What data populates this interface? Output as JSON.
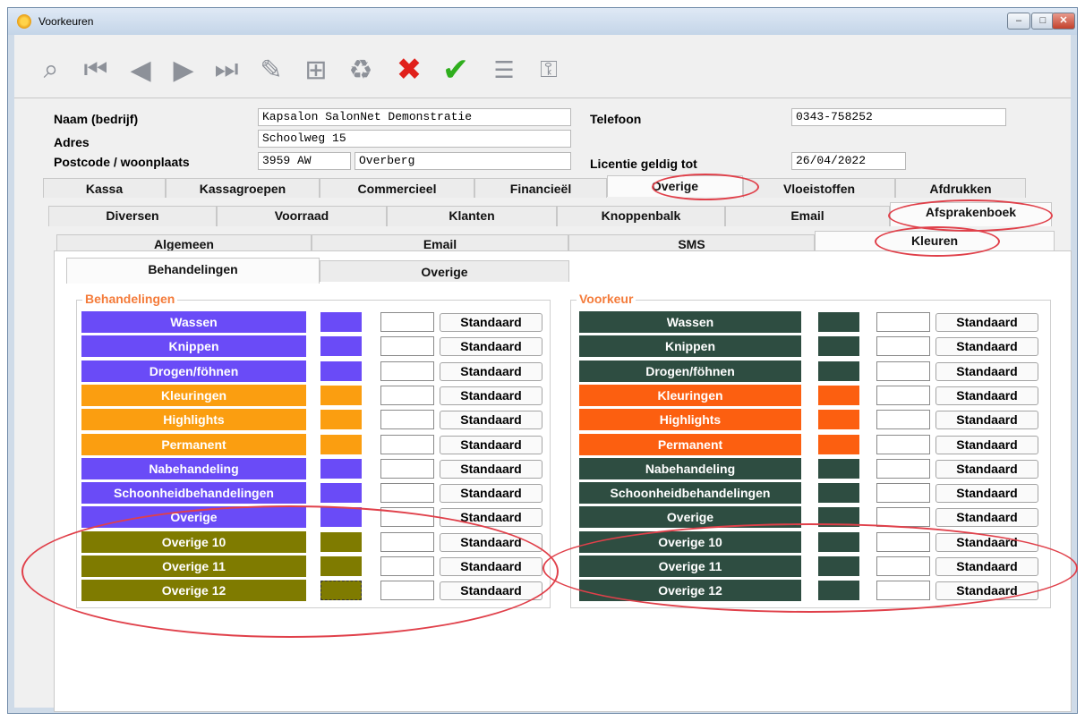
{
  "window": {
    "title": "Voorkeuren"
  },
  "toolbar": {
    "icons": [
      "search-icon",
      "first-record-icon",
      "previous-record-icon",
      "next-record-icon",
      "last-record-icon",
      "edit-icon",
      "add-icon",
      "trash-icon",
      "cancel-icon",
      "confirm-icon",
      "list-icon",
      "keys-icon"
    ]
  },
  "form": {
    "naam_label": "Naam (bedrijf)",
    "naam_value": "Kapsalon SalonNet Demonstratie",
    "adres_label": "Adres",
    "adres_value": "Schoolweg 15",
    "postcode_label": "Postcode / woonplaats",
    "postcode_value": "3959 AW",
    "woonplaats_value": "Overberg",
    "telefoon_label": "Telefoon",
    "telefoon_value": "0343-758252",
    "licentie_label": "Licentie geldig tot",
    "licentie_value": "26/04/2022"
  },
  "tabs_main": [
    "Kassa",
    "Kassagroepen",
    "Commercieel",
    "Financieël",
    "Overige",
    "Vloeistoffen",
    "Afdrukken"
  ],
  "tabs_sub": [
    "Diversen",
    "Voorraad",
    "Klanten",
    "Knoppenbalk",
    "Email",
    "Afsprakenboek"
  ],
  "tabs_sub2": [
    "Algemeen",
    "Email",
    "SMS",
    "Kleuren"
  ],
  "tabs_sub3": [
    "Behandelingen",
    "Overige"
  ],
  "groups": {
    "left_title": "Behandelingen",
    "right_title": "Voorkeur",
    "button_label": "Standaard"
  },
  "rows_left": [
    {
      "label": "Wassen",
      "color": "#6a4bf7"
    },
    {
      "label": "Knippen",
      "color": "#6a4bf7"
    },
    {
      "label": "Drogen/föhnen",
      "color": "#6a4bf7"
    },
    {
      "label": "Kleuringen",
      "color": "#fb9e10"
    },
    {
      "label": "Highlights",
      "color": "#fb9e10"
    },
    {
      "label": "Permanent",
      "color": "#fb9e10"
    },
    {
      "label": "Nabehandeling",
      "color": "#6a4bf7"
    },
    {
      "label": "Schoonheidbehandelingen",
      "color": "#6a4bf7"
    },
    {
      "label": "Overige",
      "color": "#6a4bf7"
    },
    {
      "label": "Overige 10",
      "color": "#7f7b00"
    },
    {
      "label": "Overige 11",
      "color": "#7f7b00"
    },
    {
      "label": "Overige 12",
      "color": "#7f7b00"
    }
  ],
  "rows_right": [
    {
      "label": "Wassen",
      "color": "#2e4d41"
    },
    {
      "label": "Knippen",
      "color": "#2e4d41"
    },
    {
      "label": "Drogen/föhnen",
      "color": "#2e4d41"
    },
    {
      "label": "Kleuringen",
      "color": "#fc5f10"
    },
    {
      "label": "Highlights",
      "color": "#fc5f10"
    },
    {
      "label": "Permanent",
      "color": "#fc5f10"
    },
    {
      "label": "Nabehandeling",
      "color": "#2e4d41"
    },
    {
      "label": "Schoonheidbehandelingen",
      "color": "#2e4d41"
    },
    {
      "label": "Overige",
      "color": "#2e4d41"
    },
    {
      "label": "Overige 10",
      "color": "#2e4d41"
    },
    {
      "label": "Overige 11",
      "color": "#2e4d41"
    },
    {
      "label": "Overige 12",
      "color": "#2e4d41"
    }
  ],
  "annotation_color": "#e0404a"
}
